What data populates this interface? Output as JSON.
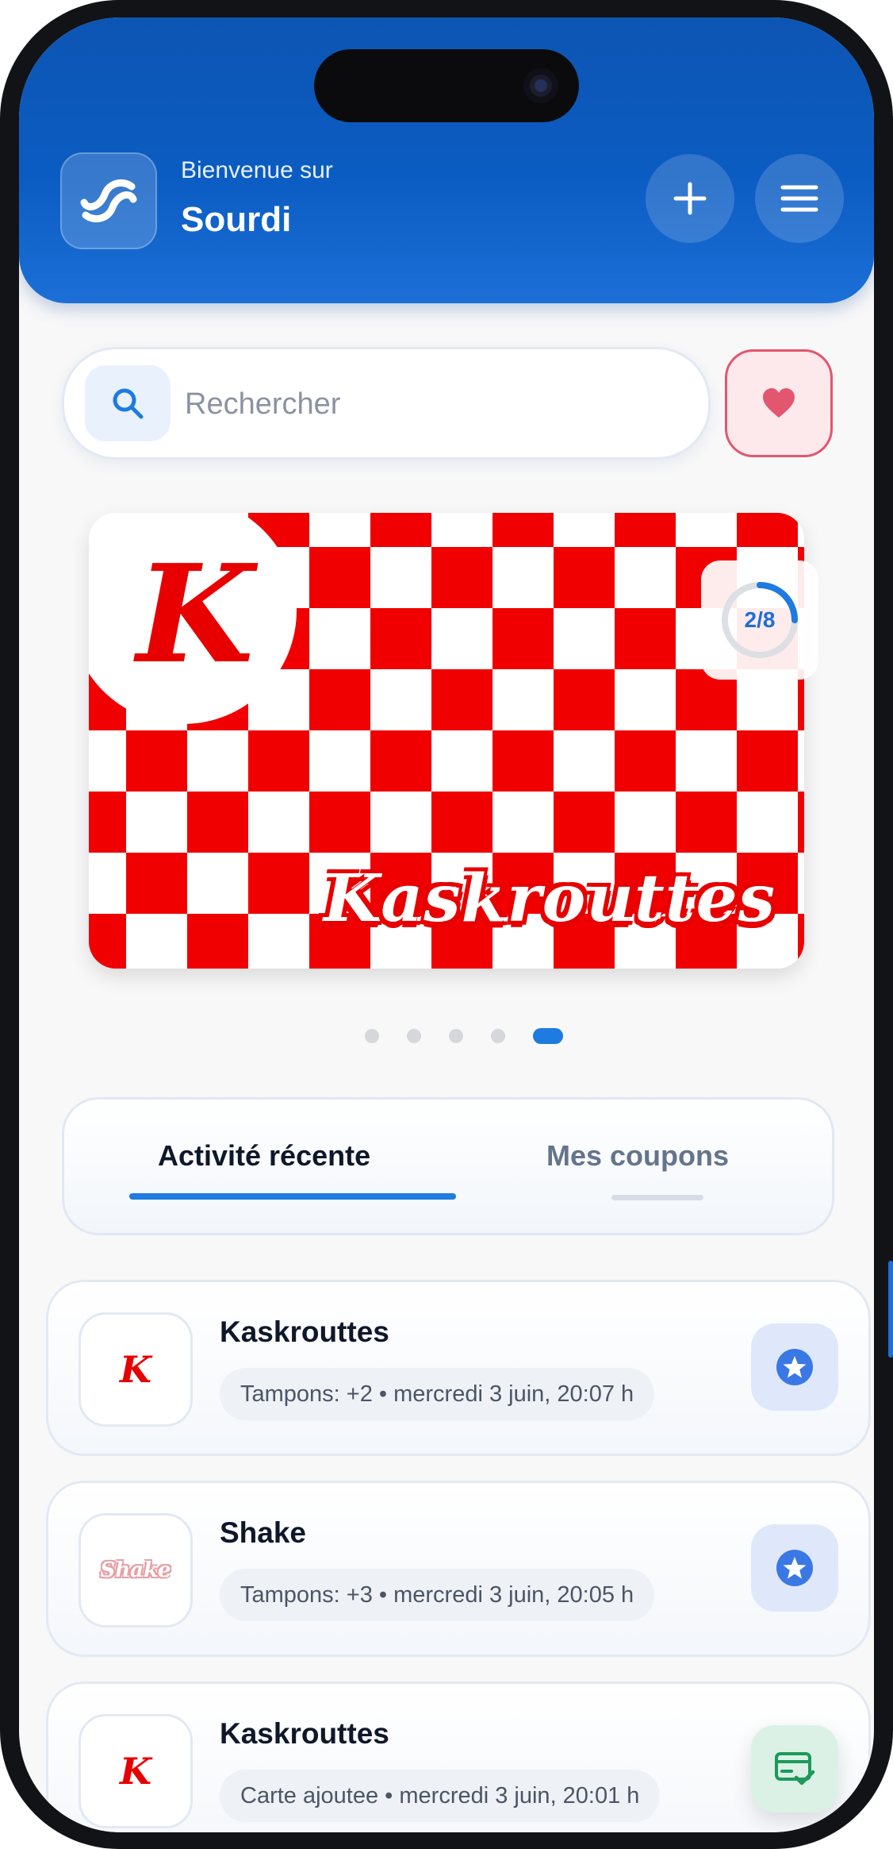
{
  "header": {
    "welcome": "Bienvenue sur",
    "app_name": "Sourdi",
    "add_icon": "plus-icon",
    "menu_icon": "menu-icon"
  },
  "search": {
    "placeholder": "Rechercher",
    "icon": "search-icon",
    "favorites_icon": "heart-icon"
  },
  "loyalty_card": {
    "logo_letter": "K",
    "name": "Kaskrouttes",
    "stamps": "2/8",
    "stamp_progress": 0.25
  },
  "carousel": {
    "count": 5,
    "active_index": 4
  },
  "tabs": [
    {
      "label": "Activité récente",
      "active": true
    },
    {
      "label": "Mes coupons",
      "active": false
    }
  ],
  "activity": [
    {
      "logo": "K",
      "title": "Kaskrouttes",
      "detail": "Tampons: +2 • mercredi 3 juin, 20:07 h",
      "icon": "star-icon"
    },
    {
      "logo": "Shake",
      "title": "Shake",
      "detail": "Tampons: +3 • mercredi 3 juin, 20:05 h",
      "icon": "star-icon"
    },
    {
      "logo": "K",
      "title": "Kaskrouttes",
      "detail": "Carte ajoutee • mercredi 3 juin, 20:01 h",
      "icon": "card-check-icon"
    }
  ],
  "colors": {
    "primary": "#1e7be0",
    "header": "#0b5cc2",
    "brand_red": "#e80000",
    "favorite": "#e2566f"
  }
}
